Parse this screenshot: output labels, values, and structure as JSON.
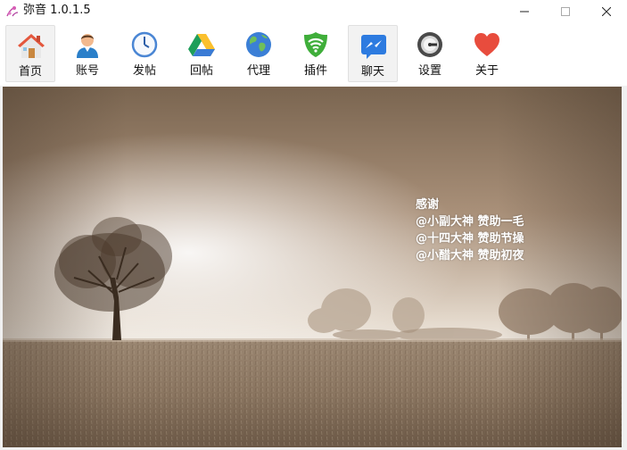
{
  "window": {
    "title": "弥音 1.0.1.5",
    "controls": {
      "minimize": "minimize-icon",
      "maximize": "maximize-icon",
      "close": "close-icon"
    }
  },
  "toolbar": {
    "items": [
      {
        "label": "首页",
        "icon": "home-icon",
        "active": true
      },
      {
        "label": "账号",
        "icon": "user-icon",
        "active": false
      },
      {
        "label": "发帖",
        "icon": "clock-icon",
        "active": false
      },
      {
        "label": "回帖",
        "icon": "drive-icon",
        "active": false
      },
      {
        "label": "代理",
        "icon": "globe-icon",
        "active": false
      },
      {
        "label": "插件",
        "icon": "wifi-shield-icon",
        "active": false
      },
      {
        "label": "聊天",
        "icon": "messenger-icon",
        "active": true
      },
      {
        "label": "设置",
        "icon": "settings-dial-icon",
        "active": false
      },
      {
        "label": "关于",
        "icon": "heart-icon",
        "active": false
      }
    ]
  },
  "banner": {
    "thanks": {
      "heading": "感谢",
      "lines": [
        "@小副大神 赞助一毛",
        "@十四大神 赞助节操",
        "@小醋大神 赞助初夜"
      ]
    }
  },
  "colors": {
    "accent": "#e84c3d",
    "sepia_dark": "#5b4a3a",
    "sepia_light": "#e9e2d8"
  }
}
